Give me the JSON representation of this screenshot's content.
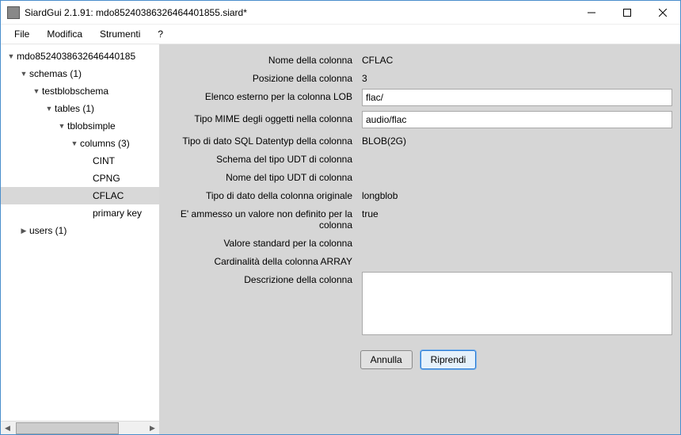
{
  "window": {
    "title": "SiardGui 2.1.91: mdo85240386326464401855.siard*"
  },
  "menu": {
    "file": "File",
    "edit": "Modifica",
    "tools": "Strumenti",
    "help": "?"
  },
  "tree": {
    "root": "mdo8524038632646440185",
    "nodes": {
      "schemas": "schemas (1)",
      "testblobschema": "testblobschema",
      "tables": "tables (1)",
      "tblobsimple": "tblobsimple",
      "columns": "columns (3)",
      "cint": "CINT",
      "cpng": "CPNG",
      "cflac": "CFLAC",
      "primarykey": "primary key",
      "users": "users (1)"
    }
  },
  "form": {
    "labels": {
      "name": "Nome della colonna",
      "position": "Posizione della colonna",
      "lobfolder": "Elenco esterno per la colonna LOB",
      "mimetype": "Tipo MIME degli oggetti nella colonna",
      "sqltype": "Tipo di dato SQL Datentyp della colonna",
      "udtschema": "Schema del tipo UDT di colonna",
      "udtname": "Nome del tipo UDT di colonna",
      "origtype": "Tipo di dato della colonna originale",
      "nullable": "E' ammesso un valore non definito per la colonna",
      "default": "Valore standard per la colonna",
      "cardinality": "Cardinalità della colonna ARRAY",
      "description": "Descrizione della colonna"
    },
    "values": {
      "name": "CFLAC",
      "position": "3",
      "lobfolder": "flac/",
      "mimetype": "audio/flac",
      "sqltype": "BLOB(2G)",
      "udtschema": "",
      "udtname": "",
      "origtype": "longblob",
      "nullable": "true",
      "default": "",
      "cardinality": "",
      "description": ""
    }
  },
  "buttons": {
    "cancel": "Annulla",
    "apply": "Riprendi"
  }
}
